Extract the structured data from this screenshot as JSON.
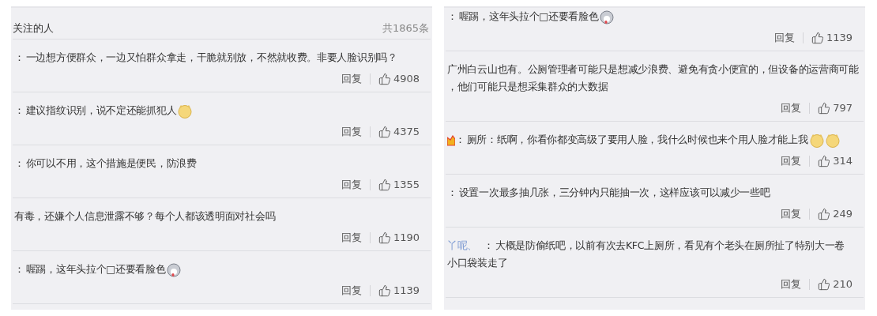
{
  "panels": [
    {
      "header": {
        "title": "关注的人",
        "count": "共1865条"
      },
      "comments": [
        {
          "prefix": "：",
          "lines": [
            "一边想方便群众，一边又怕群众拿走，干脆就别放，不然就收费。非要人脸识别吗？"
          ],
          "reply": "回复",
          "likes": "4908"
        },
        {
          "prefix": "：",
          "lines": [
            "建议指纹识别，说不定还能抓犯人"
          ],
          "emojis": [
            {
              "kind": "doge"
            }
          ],
          "reply": "回复",
          "likes": "4375"
        },
        {
          "prefix": "：",
          "lines": [
            "你可以不用，这个措施是便民，防浪费"
          ],
          "reply": "回复",
          "likes": "1355"
        },
        {
          "lines": [
            "有毒，还嫌个人信息泄露不够？每个人都该透明面对社会吗"
          ],
          "reply": "回复",
          "likes": "1190"
        },
        {
          "prefix": "：",
          "lines": [
            "喔踢，这年头拉个□还要看脸色"
          ],
          "emojis": [
            {
              "kind": "husky"
            }
          ],
          "reply": "回复",
          "likes": "1139"
        }
      ]
    },
    {
      "comments": [
        {
          "prefix": "：",
          "lines": [
            "喔踢，这年头拉个□还要看脸色"
          ],
          "emojis": [
            {
              "kind": "husky"
            }
          ],
          "reply": "回复",
          "likes": "1139"
        },
        {
          "lines": [
            "广州白云山也有。公厕管理者可能只是想减少浪费、避免有贪小便宜的，但设备的运营商可能",
            "，他们可能只是想采集群众的大数据"
          ],
          "reply": "回复",
          "likes": "797"
        },
        {
          "badge": {
            "kind": "crown"
          },
          "prefix": "：",
          "lines": [
            "厕所：纸啊，你看你都变高级了要用人脸，我什么时候也来个用人脸才能上我"
          ],
          "emojis": [
            {
              "kind": "doge"
            },
            {
              "kind": "doge"
            }
          ],
          "reply": "回复",
          "likes": "314"
        },
        {
          "prefix": "：",
          "lines": [
            "设置一次最多抽几张，三分钟内只能抽一次，这样应该可以减少一些吧"
          ],
          "reply": "回复",
          "likes": "249"
        },
        {
          "user": "丫呢、",
          "prefix": "：",
          "lines": [
            "大概是防偷纸吧，以前有次去KFC上厕所，看见有个老头在厕所扯了特别大一卷",
            "小口袋装走了"
          ],
          "reply": "回复",
          "likes": "210"
        }
      ]
    }
  ]
}
